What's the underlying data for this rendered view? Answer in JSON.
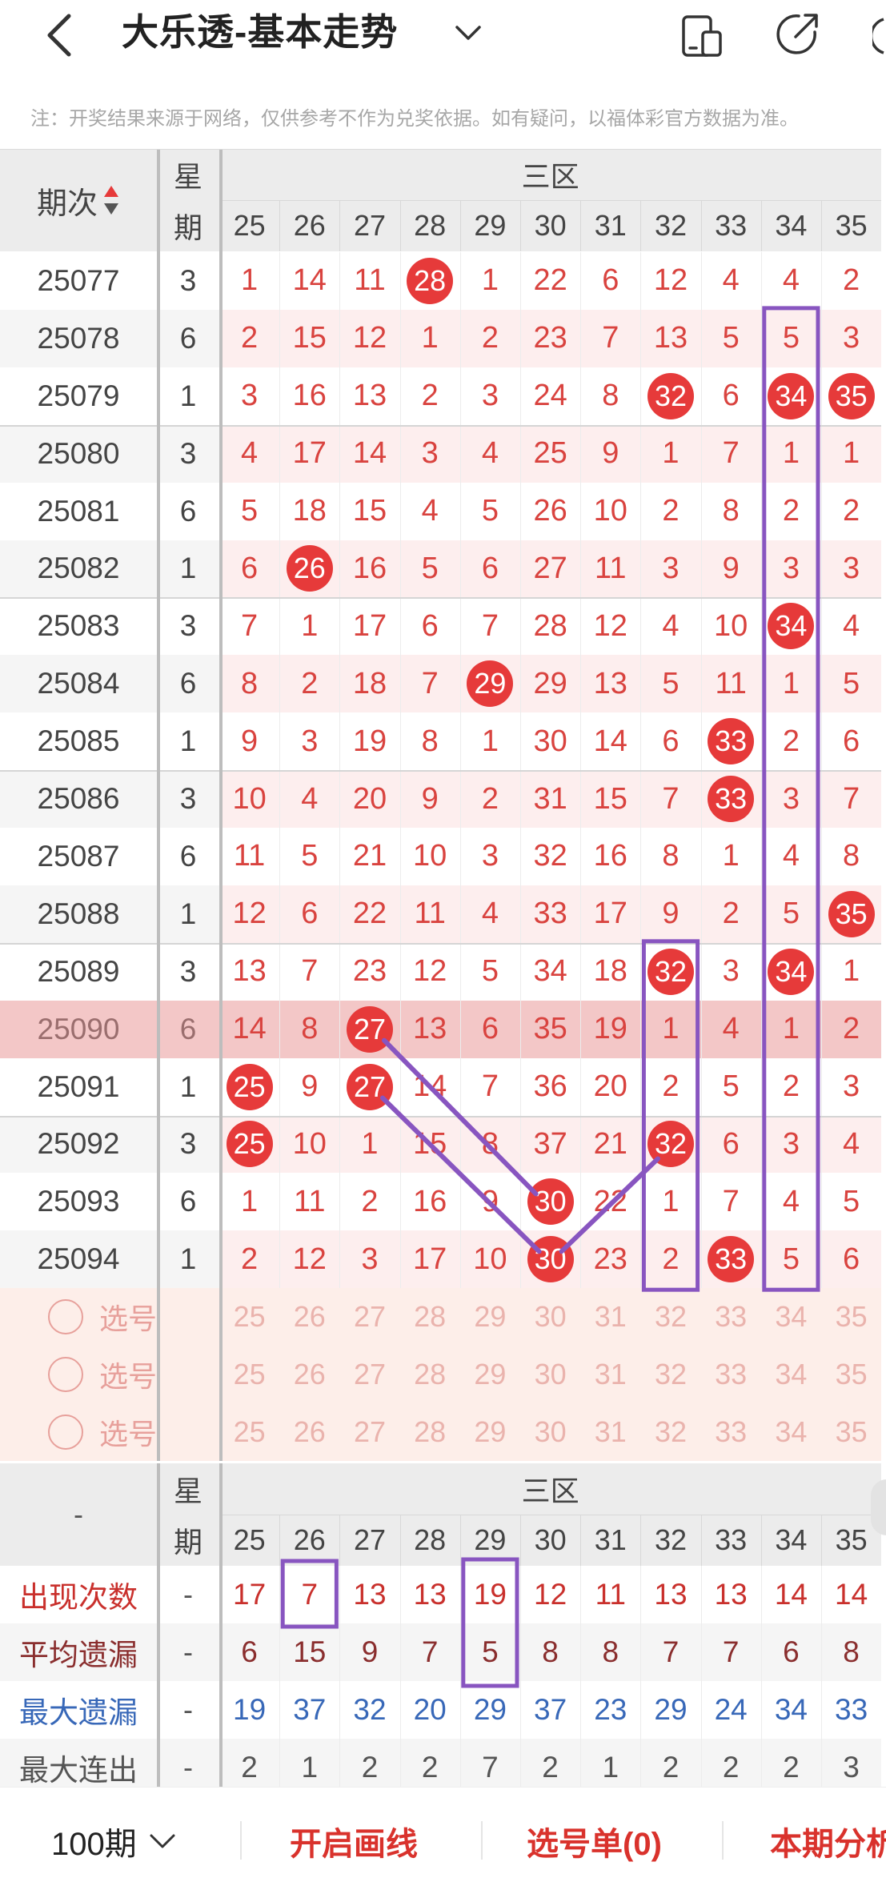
{
  "header": {
    "title": "大乐透-基本走势",
    "notice": "注：开奖结果来源于网络，仅供参考不作为兑奖依据。如有疑问，以福体彩官方数据为准。"
  },
  "table": {
    "col_issue": "期次",
    "col_week_1": "星",
    "col_week_2": "期",
    "zone": "三区",
    "numbers": [
      "25",
      "26",
      "27",
      "28",
      "29",
      "30",
      "31",
      "32",
      "33",
      "34",
      "35"
    ],
    "rows": [
      {
        "issue": "25077",
        "week": "3",
        "cells": [
          "1",
          "14",
          "11",
          "28",
          "1",
          "22",
          "6",
          "12",
          "4",
          "4",
          "2"
        ],
        "hits": [
          3
        ]
      },
      {
        "issue": "25078",
        "week": "6",
        "cells": [
          "2",
          "15",
          "12",
          "1",
          "2",
          "23",
          "7",
          "13",
          "5",
          "5",
          "3"
        ],
        "hits": []
      },
      {
        "issue": "25079",
        "week": "1",
        "cells": [
          "3",
          "16",
          "13",
          "2",
          "3",
          "24",
          "8",
          "32",
          "6",
          "34",
          "35"
        ],
        "hits": [
          7,
          9,
          10
        ]
      },
      {
        "issue": "25080",
        "week": "3",
        "cells": [
          "4",
          "17",
          "14",
          "3",
          "4",
          "25",
          "9",
          "1",
          "7",
          "1",
          "1"
        ],
        "hits": []
      },
      {
        "issue": "25081",
        "week": "6",
        "cells": [
          "5",
          "18",
          "15",
          "4",
          "5",
          "26",
          "10",
          "2",
          "8",
          "2",
          "2"
        ],
        "hits": []
      },
      {
        "issue": "25082",
        "week": "1",
        "cells": [
          "6",
          "26",
          "16",
          "5",
          "6",
          "27",
          "11",
          "3",
          "9",
          "3",
          "3"
        ],
        "hits": [
          1
        ]
      },
      {
        "issue": "25083",
        "week": "3",
        "cells": [
          "7",
          "1",
          "17",
          "6",
          "7",
          "28",
          "12",
          "4",
          "10",
          "34",
          "4"
        ],
        "hits": [
          9
        ]
      },
      {
        "issue": "25084",
        "week": "6",
        "cells": [
          "8",
          "2",
          "18",
          "7",
          "29",
          "29",
          "13",
          "5",
          "11",
          "1",
          "5"
        ],
        "hits": [
          4
        ]
      },
      {
        "issue": "25085",
        "week": "1",
        "cells": [
          "9",
          "3",
          "19",
          "8",
          "1",
          "30",
          "14",
          "6",
          "33",
          "2",
          "6"
        ],
        "hits": [
          8
        ]
      },
      {
        "issue": "25086",
        "week": "3",
        "cells": [
          "10",
          "4",
          "20",
          "9",
          "2",
          "31",
          "15",
          "7",
          "33",
          "3",
          "7"
        ],
        "hits": [
          8
        ]
      },
      {
        "issue": "25087",
        "week": "6",
        "cells": [
          "11",
          "5",
          "21",
          "10",
          "3",
          "32",
          "16",
          "8",
          "1",
          "4",
          "8"
        ],
        "hits": []
      },
      {
        "issue": "25088",
        "week": "1",
        "cells": [
          "12",
          "6",
          "22",
          "11",
          "4",
          "33",
          "17",
          "9",
          "2",
          "5",
          "35"
        ],
        "hits": [
          10
        ]
      },
      {
        "issue": "25089",
        "week": "3",
        "cells": [
          "13",
          "7",
          "23",
          "12",
          "5",
          "34",
          "18",
          "32",
          "3",
          "34",
          "1"
        ],
        "hits": [
          7,
          9
        ]
      },
      {
        "issue": "25090",
        "week": "6",
        "cells": [
          "14",
          "8",
          "27",
          "13",
          "6",
          "35",
          "19",
          "1",
          "4",
          "1",
          "2"
        ],
        "hits": [
          2
        ]
      },
      {
        "issue": "25091",
        "week": "1",
        "cells": [
          "25",
          "9",
          "27",
          "14",
          "7",
          "36",
          "20",
          "2",
          "5",
          "2",
          "3"
        ],
        "hits": [
          0,
          2
        ]
      },
      {
        "issue": "25092",
        "week": "3",
        "cells": [
          "25",
          "10",
          "1",
          "15",
          "8",
          "37",
          "21",
          "32",
          "6",
          "3",
          "4"
        ],
        "hits": [
          0,
          7
        ]
      },
      {
        "issue": "25093",
        "week": "6",
        "cells": [
          "1",
          "11",
          "2",
          "16",
          "9",
          "30",
          "22",
          "1",
          "7",
          "4",
          "5"
        ],
        "hits": [
          5
        ]
      },
      {
        "issue": "25094",
        "week": "1",
        "cells": [
          "2",
          "12",
          "3",
          "17",
          "10",
          "30",
          "23",
          "2",
          "33",
          "5",
          "6"
        ],
        "hits": [
          5,
          8
        ]
      }
    ],
    "select_label": "选号",
    "select_rows": 3
  },
  "stats": {
    "dash": "-",
    "col_week_1": "星",
    "col_week_2": "期",
    "zone": "三区",
    "rows": [
      {
        "label": "出现次数",
        "week": "-",
        "values": [
          "17",
          "7",
          "13",
          "13",
          "19",
          "12",
          "11",
          "13",
          "13",
          "14",
          "14"
        ],
        "label_color": "#c9302c",
        "value_color": "#c9302c"
      },
      {
        "label": "平均遗漏",
        "week": "-",
        "values": [
          "6",
          "15",
          "9",
          "7",
          "5",
          "8",
          "8",
          "7",
          "7",
          "6",
          "8"
        ],
        "label_color": "#8a2e2e",
        "value_color": "#8a2e2e"
      },
      {
        "label": "最大遗漏",
        "week": "-",
        "values": [
          "19",
          "37",
          "32",
          "20",
          "29",
          "37",
          "23",
          "29",
          "24",
          "34",
          "33"
        ],
        "label_color": "#3868b8",
        "value_color": "#3868b8"
      },
      {
        "label": "最大连出",
        "week": "-",
        "values": [
          "2",
          "1",
          "2",
          "2",
          "7",
          "2",
          "1",
          "2",
          "2",
          "2",
          "3"
        ],
        "label_color": "#555555",
        "value_color": "#555555"
      }
    ]
  },
  "bottombar": {
    "periods": "100期",
    "draw_line": "开启画线",
    "picks": "选号单(0)",
    "analysis": "本期分析"
  },
  "colors": {
    "accent": "#e63a3a",
    "highlight_row": "#f3c7c7",
    "select_bg": "#fdeee9",
    "annotation": "#8855c0"
  }
}
